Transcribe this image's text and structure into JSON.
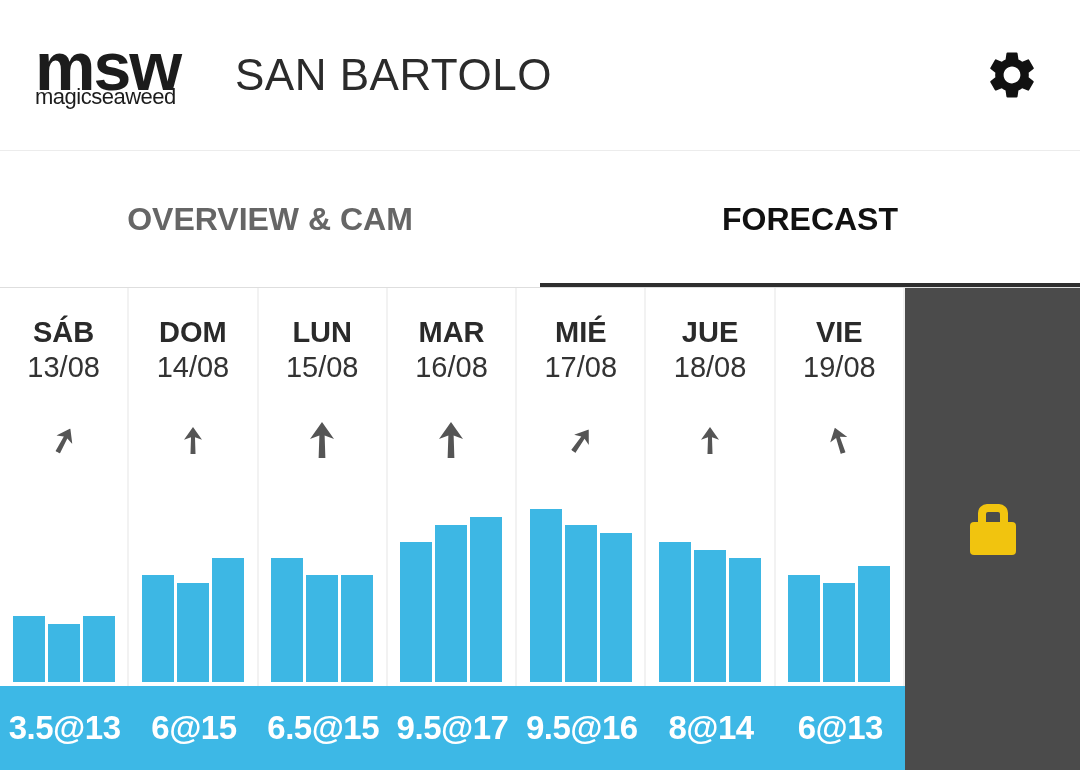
{
  "header": {
    "logo": {
      "mark": "msw",
      "wordmark": "magicseaweed"
    },
    "title": "SAN BARTOLO"
  },
  "tabs": [
    {
      "label": "OVERVIEW & CAM",
      "selected": false
    },
    {
      "label": "FORECAST",
      "selected": true
    }
  ],
  "days": [
    {
      "name": "SÁB",
      "date": "13/08",
      "swell": "3.5@13"
    },
    {
      "name": "DOM",
      "date": "14/08",
      "swell": "6@15"
    },
    {
      "name": "LUN",
      "date": "15/08",
      "swell": "6.5@15"
    },
    {
      "name": "MAR",
      "date": "16/08",
      "swell": "9.5@17"
    },
    {
      "name": "MIÉ",
      "date": "17/08",
      "swell": "9.5@16"
    },
    {
      "name": "JUE",
      "date": "18/08",
      "swell": "8@14"
    },
    {
      "name": "VIE",
      "date": "19/08",
      "swell": "6@13"
    }
  ],
  "locked_day": {
    "locked": true
  }
}
